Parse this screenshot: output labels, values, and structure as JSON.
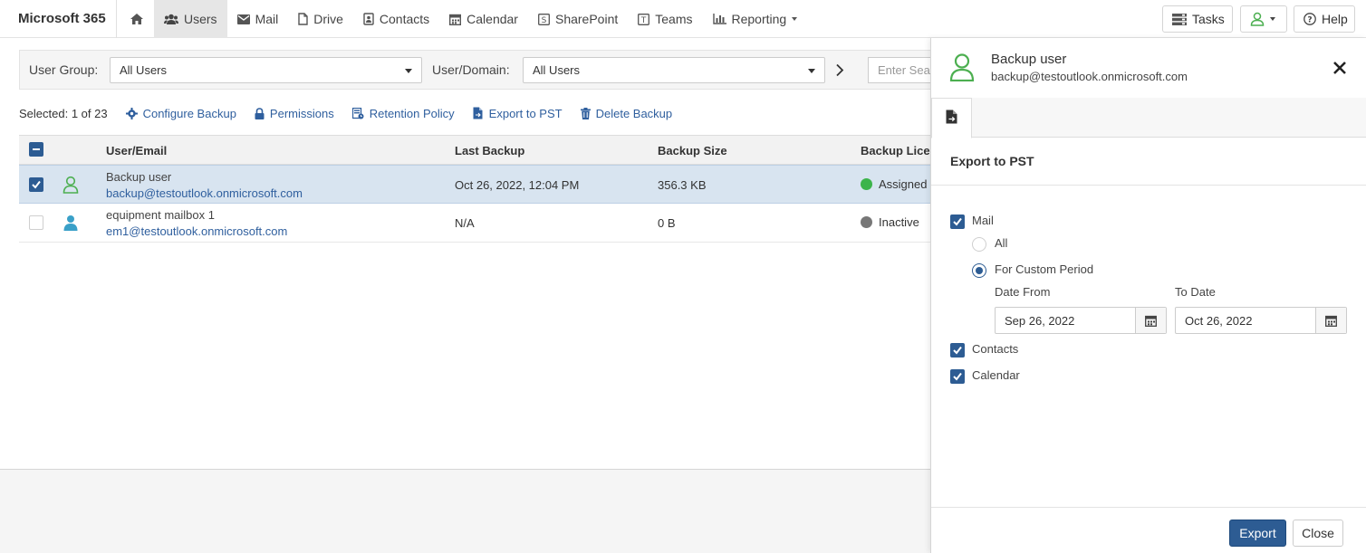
{
  "brand": "Microsoft 365",
  "nav": {
    "items": [
      {
        "label": ""
      },
      {
        "label": "Users"
      },
      {
        "label": "Mail"
      },
      {
        "label": "Drive"
      },
      {
        "label": "Contacts"
      },
      {
        "label": "Calendar"
      },
      {
        "label": "SharePoint"
      },
      {
        "label": "Teams"
      },
      {
        "label": "Reporting"
      }
    ],
    "tasks_label": "Tasks",
    "help_label": "Help"
  },
  "filter": {
    "user_group_label": "User Group:",
    "user_group_value": "All Users",
    "user_domain_label": "User/Domain:",
    "user_domain_value": "All Users",
    "search_placeholder": "Enter Search"
  },
  "actions": {
    "selected": "Selected: 1 of 23",
    "configure_backup": "Configure Backup",
    "permissions": "Permissions",
    "retention_policy": "Retention Policy",
    "export_to_pst": "Export to PST",
    "delete_backup": "Delete Backup"
  },
  "table": {
    "columns": [
      "User/Email",
      "Last Backup",
      "Backup Size",
      "Backup License"
    ],
    "rows": [
      {
        "name": "Backup user",
        "email": "backup@testoutlook.onmicrosoft.com",
        "last_backup": "Oct 26, 2022, 12:04 PM",
        "size": "356.3 KB",
        "license": "Assigned",
        "license_color": "#3cb44b",
        "checked": true
      },
      {
        "name": "equipment mailbox 1",
        "email": "em1@testoutlook.onmicrosoft.com",
        "last_backup": "N/A",
        "size": "0 B",
        "license": "Inactive",
        "license_color": "#777777",
        "checked": false
      }
    ]
  },
  "panel": {
    "title": "Backup user",
    "subtitle": "backup@testoutlook.onmicrosoft.com",
    "section_title": "Export to PST",
    "mail_label": "Mail",
    "all_label": "All",
    "custom_period_label": "For Custom Period",
    "date_from_label": "Date From",
    "date_from_value": "Sep 26, 2022",
    "to_date_label": "To Date",
    "to_date_value": "Oct 26, 2022",
    "contacts_label": "Contacts",
    "calendar_label": "Calendar",
    "export_button": "Export",
    "close_button": "Close"
  },
  "colors": {
    "accent": "#2d5c93",
    "link": "#2f5f9e",
    "user_icon_green": "#4caf50",
    "user_icon_teal": "#3aa0c8"
  },
  "icons": [
    "home-icon",
    "users-icon",
    "mail-icon",
    "file-icon",
    "contacts-icon",
    "calendar-icon",
    "sharepoint-icon",
    "teams-icon",
    "chart-icon",
    "tasks-icon",
    "user-icon",
    "help-icon",
    "gear-icon",
    "lock-icon",
    "retention-icon",
    "export-icon",
    "trash-icon",
    "close-icon",
    "chevron-right-icon"
  ]
}
